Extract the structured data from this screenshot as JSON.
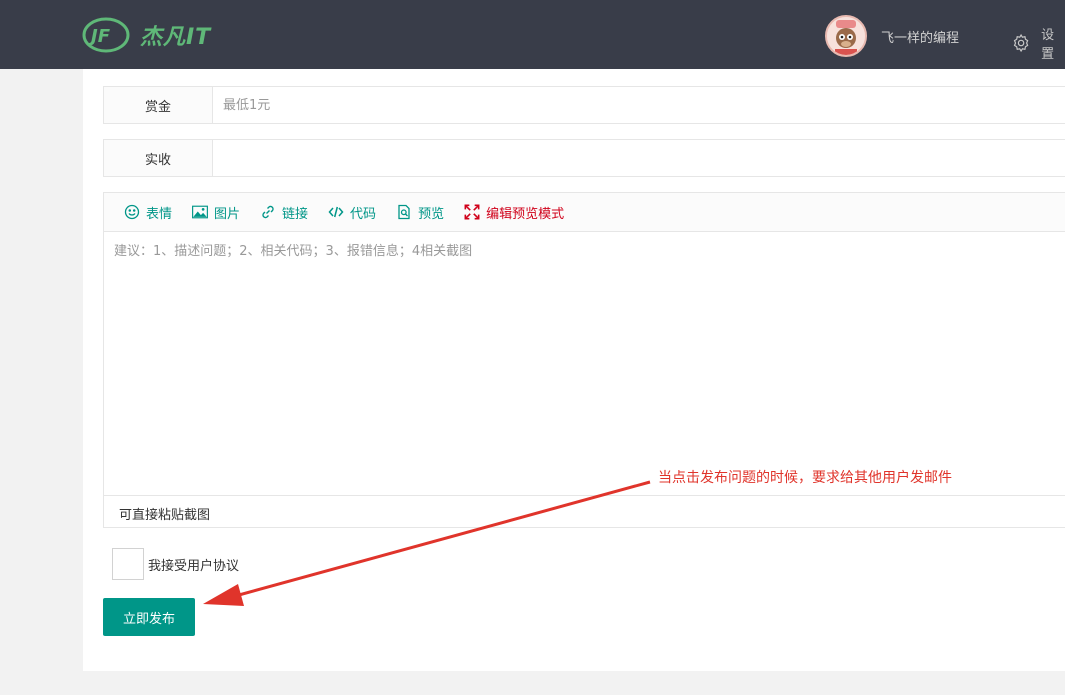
{
  "header": {
    "logo_text": "杰凡IT",
    "username": "飞一样的编程",
    "settings_label": "设置"
  },
  "form": {
    "bounty_label": "赏金",
    "bounty_placeholder": "最低1元",
    "bounty_value": "",
    "received_label": "实收",
    "received_value": ""
  },
  "editor": {
    "toolbar": [
      {
        "icon": "smile-icon",
        "label": "表情"
      },
      {
        "icon": "image-icon",
        "label": "图片"
      },
      {
        "icon": "link-icon",
        "label": "链接"
      },
      {
        "icon": "code-icon",
        "label": "代码"
      },
      {
        "icon": "preview-icon",
        "label": "预览"
      },
      {
        "icon": "fullscreen-icon",
        "label": "编辑预览模式"
      }
    ],
    "placeholder": "建议：1、描述问题；2、相关代码；3、报错信息；4相关截图",
    "footer_text": "可直接粘贴截图"
  },
  "agreement_label": "我接受用户协议",
  "submit_label": "立即发布",
  "annotation_text": "当点击发布问题的时候，要求给其他用户发邮件",
  "colors": {
    "header_bg": "#393d49",
    "accent": "#009688",
    "logo": "#5fb878",
    "annotation": "#e0342b"
  }
}
